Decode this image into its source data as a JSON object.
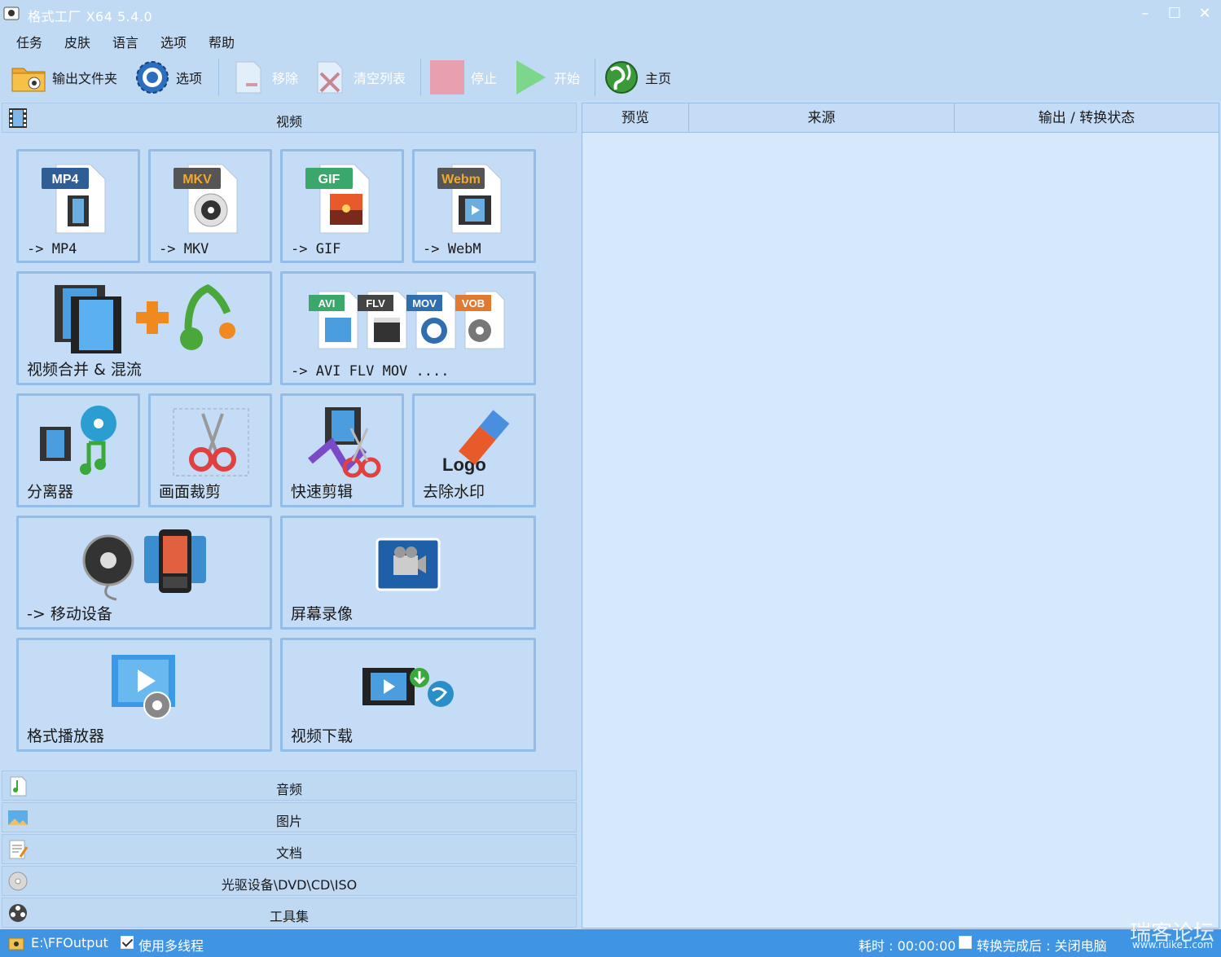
{
  "window": {
    "title": "格式工厂 X64 5.4.0",
    "minimize": "–",
    "maximize": "☐",
    "close": "✕"
  },
  "menu": [
    "任务",
    "皮肤",
    "语言",
    "选项",
    "帮助"
  ],
  "toolbar": {
    "output_folder": "输出文件夹",
    "options": "选项",
    "remove": "移除",
    "clear_list": "清空列表",
    "stop": "停止",
    "start": "开始",
    "home": "主页"
  },
  "categories": {
    "video": "视频",
    "audio": "音频",
    "image": "图片",
    "document": "文档",
    "rom": "光驱设备\\DVD\\CD\\ISO",
    "tools": "工具集"
  },
  "video_tiles": {
    "mp4": {
      "badge": "MP4",
      "label": "-> MP4"
    },
    "mkv": {
      "badge": "MKV",
      "label": "-> MKV"
    },
    "gif": {
      "badge": "GIF",
      "label": "-> GIF"
    },
    "webm": {
      "badge": "Webm",
      "label": "-> WebM"
    },
    "merge": {
      "label": "视频合并 & 混流"
    },
    "others": {
      "badges": [
        "AVI",
        "FLV",
        "MOV",
        "VOB"
      ],
      "label": "-> AVI FLV MOV ...."
    },
    "splitter": {
      "label": "分离器"
    },
    "crop": {
      "label": "画面裁剪"
    },
    "quick_clip": {
      "label": "快速剪辑"
    },
    "remove_logo": {
      "badge": "Logo",
      "label": "去除水印"
    },
    "mobile": {
      "label": "-> 移动设备"
    },
    "screen_record": {
      "label": "屏幕录像"
    },
    "player": {
      "label": "格式播放器"
    },
    "download": {
      "label": "视频下载"
    }
  },
  "task_table": {
    "columns": [
      "预览",
      "来源",
      "输出 / 转换状态"
    ]
  },
  "status": {
    "output_path": "E:\\FFOutput",
    "multithread": "使用多线程",
    "elapsed": "耗时 : 00:00:00",
    "after_done": "转换完成后 : 关闭电脑",
    "watermark": "瑞客论坛",
    "watermark_url": "www.ruike1.com"
  },
  "colors": {
    "background": "#c4dcf5",
    "tile_border": "#93bde8",
    "status_bar": "#3f95e4",
    "table_bg": "#d6e9fc"
  }
}
